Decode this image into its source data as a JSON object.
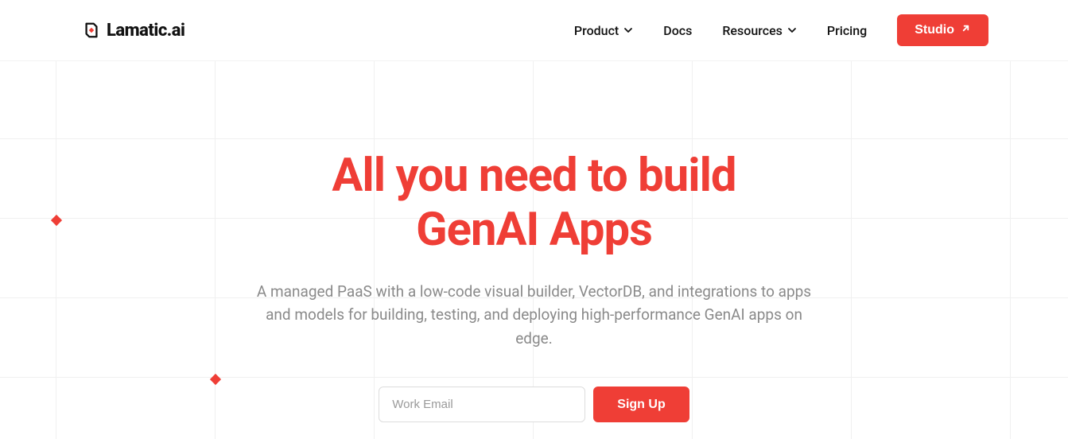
{
  "brand": {
    "name": "Lamatic",
    "suffix": ".ai"
  },
  "nav": {
    "items": [
      {
        "label": "Product",
        "has_dropdown": true
      },
      {
        "label": "Docs",
        "has_dropdown": false
      },
      {
        "label": "Resources",
        "has_dropdown": true
      },
      {
        "label": "Pricing",
        "has_dropdown": false
      }
    ],
    "cta": "Studio"
  },
  "hero": {
    "title_line1": "All you need to build",
    "title_line2": "GenAI Apps",
    "subtitle": "A managed PaaS with a low-code visual builder, VectorDB, and integrations to apps and models for building, testing, and deploying high-performance GenAI apps on edge."
  },
  "signup": {
    "placeholder": "Work Email",
    "button": "Sign Up"
  },
  "colors": {
    "accent": "#ef3e36"
  }
}
